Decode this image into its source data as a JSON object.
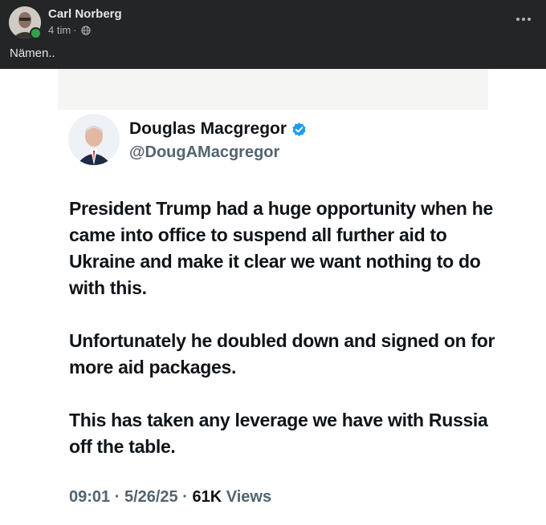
{
  "post": {
    "author": "Carl Norberg",
    "time": "4 tim",
    "separator": "·",
    "text": "Nämen..",
    "visibility_icon": "globe-icon",
    "more_icon": "more-options-icon"
  },
  "tweet": {
    "name": "Douglas Macgregor",
    "handle": "@DougAMacgregor",
    "verified_color": "#1d9bf0",
    "paragraphs": [
      "President Trump had a huge opportunity when he came into office to suspend all further aid to Ukraine and make it clear we want nothing to do with this.",
      "Unfortunately he doubled down and signed on for more aid packages.",
      "This has taken any leverage we have with Russia off the table."
    ],
    "time": "09:01",
    "date": "5/26/25",
    "views_count": "61K",
    "views_label": "Views",
    "dot": "·"
  },
  "colors": {
    "header_bg": "#242526",
    "text_primary": "#e4e6eb",
    "text_secondary": "#b0b3b8",
    "online": "#31a24c"
  }
}
